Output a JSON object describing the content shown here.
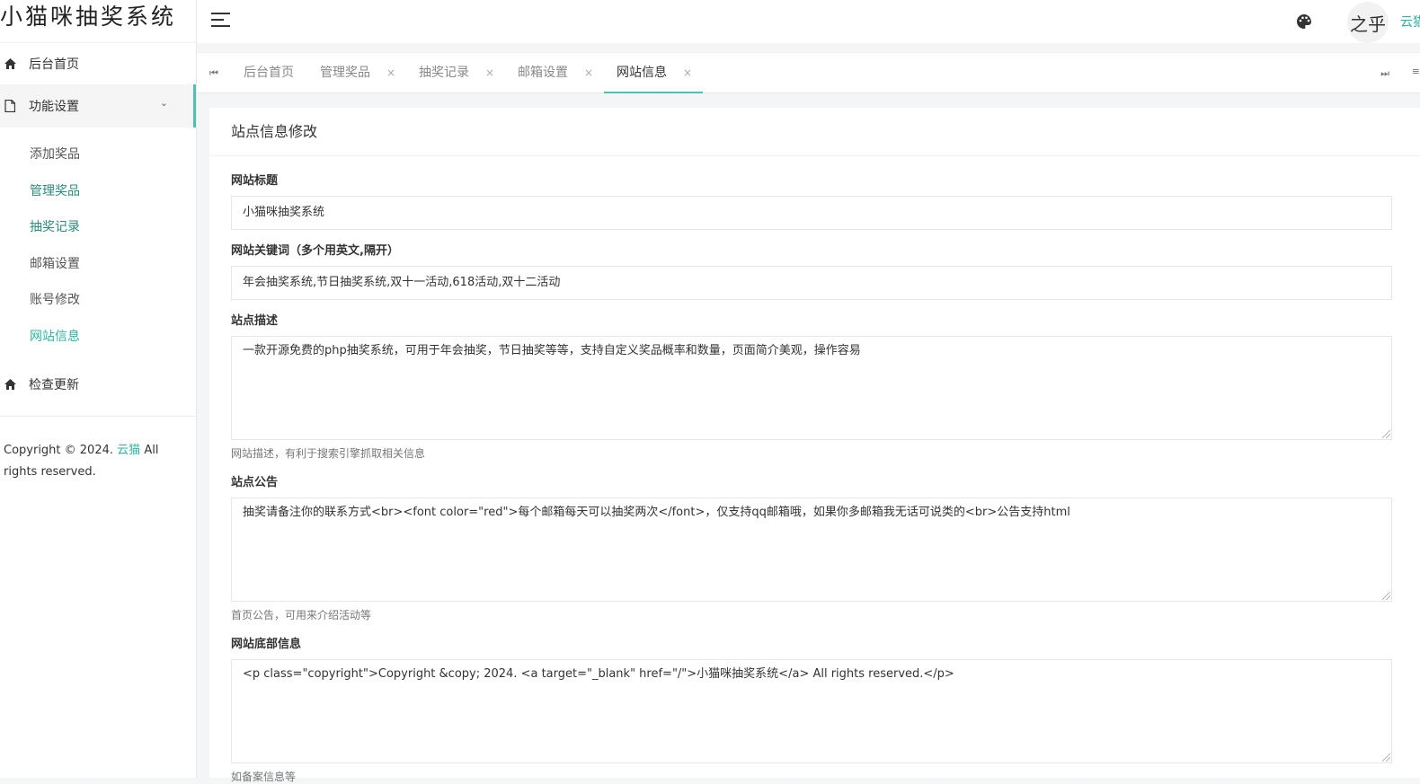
{
  "app": {
    "logo_text": "小猫咪抽奖系统"
  },
  "sidebar": {
    "home_label": "后台首页",
    "group_label": "功能设置",
    "sub_items": [
      "添加奖品",
      "管理奖品",
      "抽奖记录",
      "邮箱设置",
      "账号修改",
      "网站信息"
    ],
    "check_update_label": "检查更新",
    "copyright_prefix": "Copyright © 2024.",
    "copyright_link": "云猫",
    "copyright_suffix": "All rights reserved."
  },
  "header": {
    "username": "云猫",
    "avatar_text": "之乎"
  },
  "tabs": [
    {
      "label": "后台首页",
      "closable": false
    },
    {
      "label": "管理奖品",
      "closable": true
    },
    {
      "label": "抽奖记录",
      "closable": true
    },
    {
      "label": "邮箱设置",
      "closable": true
    },
    {
      "label": "网站信息",
      "closable": true,
      "active": true
    }
  ],
  "form": {
    "title": "站点信息修改",
    "site_title": {
      "label": "网站标题",
      "value": "小猫咪抽奖系统"
    },
    "keywords": {
      "label": "网站关键词（多个用英文,隔开）",
      "value": "年会抽奖系统,节日抽奖系统,双十一活动,618活动,双十二活动"
    },
    "description": {
      "label": "站点描述",
      "value": "一款开源免费的php抽奖系统，可用于年会抽奖，节日抽奖等等，支持自定义奖品概率和数量，页面简介美观，操作容易",
      "hint": "网站描述，有利于搜索引擎抓取相关信息"
    },
    "notice": {
      "label": "站点公告",
      "value": "抽奖请备注你的联系方式<br><font  color=\"red\">每个邮箱每天可以抽奖两次</font>，仅支持qq邮箱哦，如果你多邮箱我无话可说类的<br>公告支持html",
      "hint": "首页公告，可用来介绍活动等"
    },
    "footer": {
      "label": "网站底部信息",
      "value": "<p class=\"copyright\">Copyright &copy; 2024. <a target=\"_blank\" href=\"/\">小猫咪抽奖系统</a> All rights reserved.</p>",
      "hint": "如备案信息等"
    }
  },
  "colors": {
    "accent": "#4fc1b3",
    "link": "#2fb3a3"
  }
}
